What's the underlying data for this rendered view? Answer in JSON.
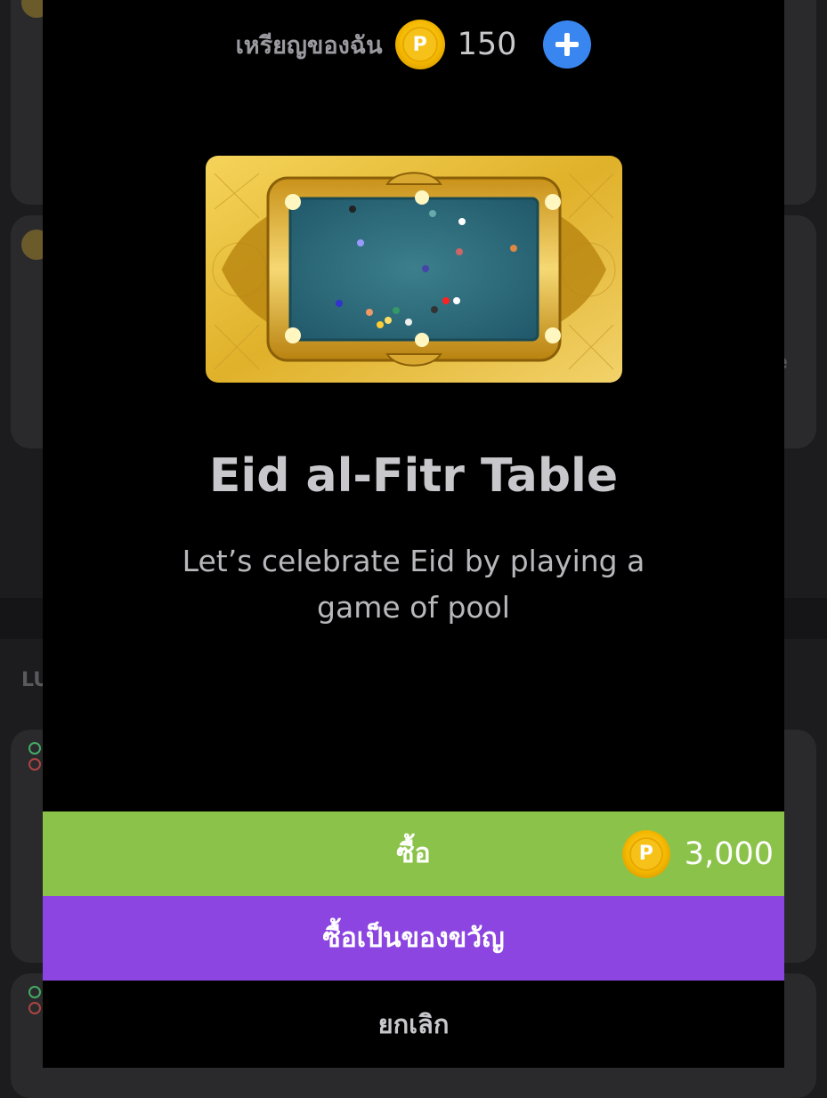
{
  "header": {
    "coins_label": "เหรียญของฉัน",
    "coin_symbol": "P",
    "coin_balance": "150",
    "add_icon": "plus-icon"
  },
  "item": {
    "image": "eid-al-fitr-pool-table",
    "title": "Eid al-Fitr Table",
    "description": "Let’s celebrate Eid by playing a game of pool"
  },
  "actions": {
    "buy_label": "ซื้อ",
    "buy_price": "3,000",
    "gift_label": "ซื้อเป็นของขวัญ",
    "cancel_label": "ยกเลิก"
  },
  "background": {
    "partial_text": "LU",
    "partial_text_2": "e"
  },
  "colors": {
    "buy": "#8bc34a",
    "gift": "#8c45e0",
    "plus": "#3a86f0",
    "coin": "#f4b800"
  }
}
